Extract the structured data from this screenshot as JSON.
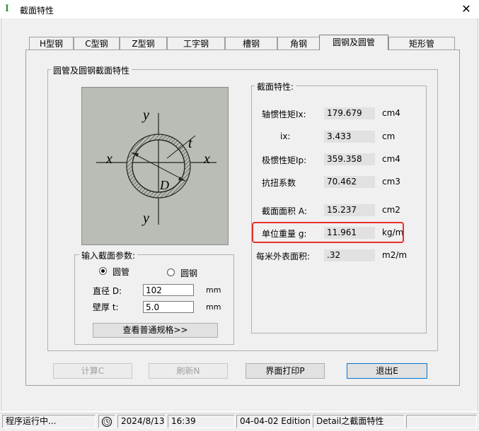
{
  "window": {
    "title": "截面特性",
    "app_icon": "I",
    "close_glyph": "✕"
  },
  "tabs": [
    {
      "label": "H型钢"
    },
    {
      "label": "C型钢"
    },
    {
      "label": "Z型钢"
    },
    {
      "label": "工字钢"
    },
    {
      "label": "槽钢"
    },
    {
      "label": "角钢"
    },
    {
      "label": "圆钢及圆管"
    },
    {
      "label": "矩形管"
    }
  ],
  "active_tab": 6,
  "section_group_title": "圆管及圆钢截面特性",
  "diagram": {
    "labels": {
      "y_top": "y",
      "y_bottom": "y",
      "x_left": "x",
      "x_right": "x",
      "t": "t",
      "D": "D"
    },
    "colors": {
      "background": "#b9bdb5",
      "hatch": "#555555"
    }
  },
  "input_group": {
    "title": "输入截面参数:",
    "radio_tube": "圆管",
    "radio_bar": "圆钢",
    "selected": "圆管",
    "diameter_label": "直径 D:",
    "diameter_value": "102",
    "diameter_unit": "mm",
    "thickness_label": "壁厚 t:",
    "thickness_value": "5.0",
    "thickness_unit": "mm",
    "spec_button": "查看普通规格>>"
  },
  "props_group": {
    "title": "截面特性:",
    "rows": [
      {
        "label": "轴惯性矩Ix:",
        "value": "179.679",
        "unit": "cm4"
      },
      {
        "label": "ix:",
        "value": "3.433",
        "unit": "cm"
      },
      {
        "label": "极惯性矩Ip:",
        "value": "359.358",
        "unit": "cm4"
      },
      {
        "label": "抗扭系数",
        "value": "70.462",
        "unit": "cm3"
      },
      {
        "label": "截面面积 A:",
        "value": "15.237",
        "unit": "cm2"
      },
      {
        "label": "单位重量 g:",
        "value": "11.961",
        "unit": "kg/m"
      },
      {
        "label": "每米外表面积:",
        "value": ".32",
        "unit": "m2/m"
      }
    ],
    "highlight_color": "#e8302a"
  },
  "buttons": {
    "calc": "计算C",
    "refresh": "刷新N",
    "print": "界面打印P",
    "exit": "退出E"
  },
  "status": {
    "state": "程序运行中...",
    "date": "2024/8/13",
    "time": "16:39",
    "edition": "04-04-02 Edition",
    "context": "Detail之截面特性"
  }
}
